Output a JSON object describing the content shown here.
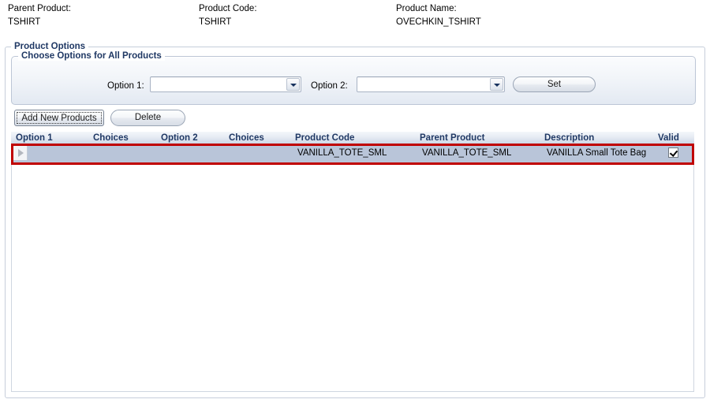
{
  "header": {
    "fields": [
      {
        "caption": "Parent Product:",
        "value": "TSHIRT"
      },
      {
        "caption": "Product Code:",
        "value": "TSHIRT"
      },
      {
        "caption": "Product Name:",
        "value": "OVECHKIN_TSHIRT"
      }
    ]
  },
  "groups": {
    "outer_legend": "Product Options",
    "inner_legend": "Choose Options for All Products"
  },
  "form": {
    "option1_label": "Option 1:",
    "option1_value": "",
    "option1_placeholder": "",
    "option2_label": "Option 2:",
    "option2_value": "",
    "option2_placeholder": "",
    "set_button": "Set",
    "dropdown_icon": "chevron-down-icon"
  },
  "toolbar": {
    "add_button": "Add New Products",
    "delete_button": "Delete"
  },
  "grid": {
    "columns": [
      "Option 1",
      "Choices",
      "Option 2",
      "Choices",
      "Product Code",
      "Parent Product",
      "Description",
      "Valid"
    ],
    "rows": [
      {
        "indicator": "row-select-arrow-icon",
        "option1": "",
        "choices1": "",
        "option2": "",
        "choices2": "",
        "product_code": "VANILLA_TOTE_SML",
        "parent_product": "VANILLA_TOTE_SML",
        "description": "VANILLA Small Tote Bag",
        "valid": true
      }
    ]
  },
  "colors": {
    "accent_red": "#c00000",
    "header_text": "#1f3864",
    "row_fill": "#b9c5d9"
  }
}
